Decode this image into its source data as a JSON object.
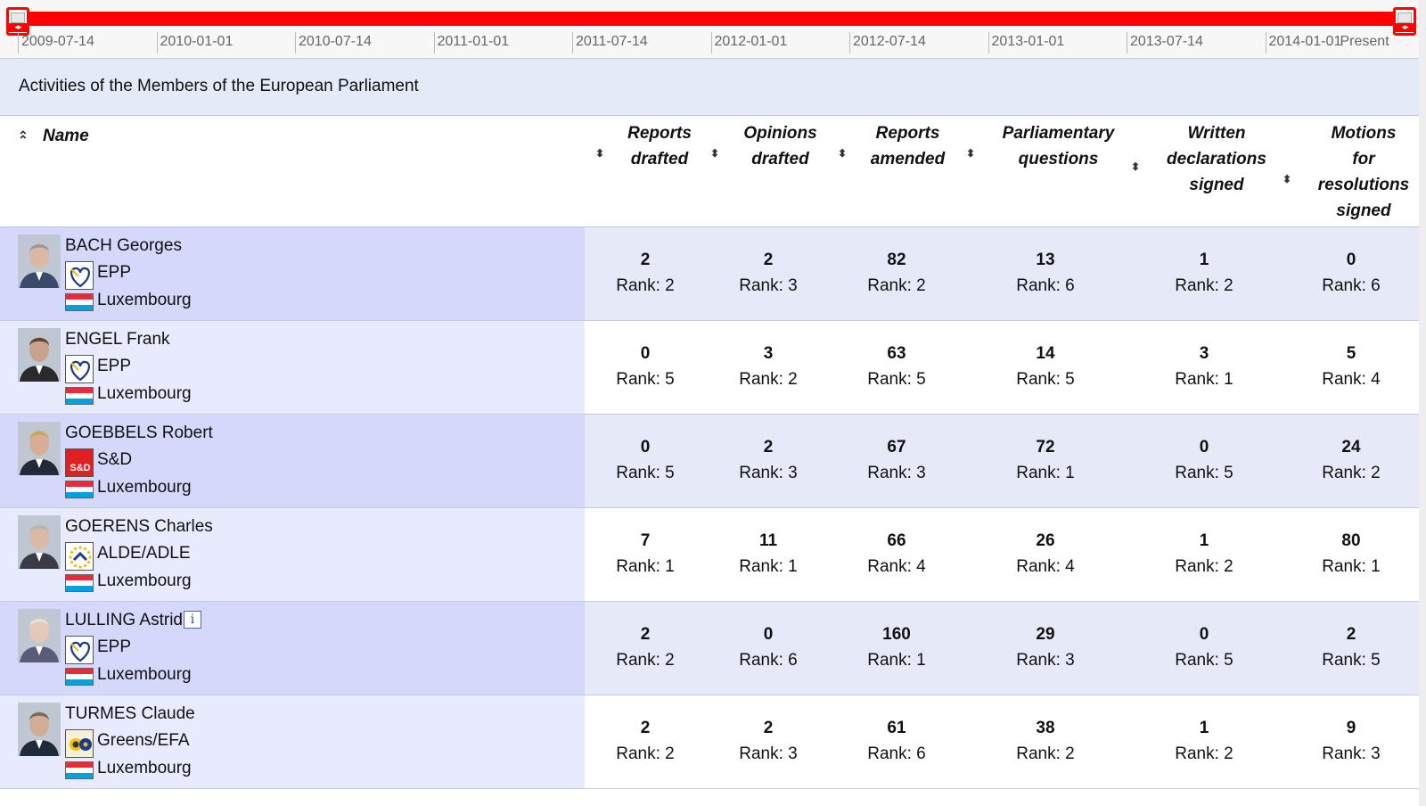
{
  "timeline": {
    "ticks": [
      "2009-07-14",
      "2010-01-01",
      "2010-07-14",
      "2011-01-01",
      "2011-07-14",
      "2012-01-01",
      "2012-07-14",
      "2013-01-01",
      "2013-07-14",
      "2014-01-01"
    ],
    "end_label": "Present",
    "track_color": "#ff0000"
  },
  "page_title": "Activities of the Members of the European Parliament",
  "columns": {
    "name": "Name",
    "reports_drafted": [
      "Reports",
      "drafted"
    ],
    "opinions_drafted": [
      "Opinions",
      "drafted"
    ],
    "reports_amended": [
      "Reports",
      "amended"
    ],
    "parliamentary_questions": [
      "Parliamentary",
      "questions"
    ],
    "written_declarations": [
      "Written",
      "declarations",
      "signed"
    ],
    "motions": [
      "Motions",
      "for",
      "resolutions",
      "signed"
    ]
  },
  "icons": {
    "sort_asc": "double-chevron-up-icon",
    "sort_both": "up-down-icon",
    "info": "info-icon"
  },
  "members": [
    {
      "name": "BACH Georges",
      "has_info": false,
      "party": "EPP",
      "party_logo": "epp-heart-icon",
      "country": "Luxembourg",
      "stats": [
        {
          "value": "2",
          "rank": "Rank: 2"
        },
        {
          "value": "2",
          "rank": "Rank: 3"
        },
        {
          "value": "82",
          "rank": "Rank: 2"
        },
        {
          "value": "13",
          "rank": "Rank: 6"
        },
        {
          "value": "1",
          "rank": "Rank: 2"
        },
        {
          "value": "0",
          "rank": "Rank: 6"
        }
      ]
    },
    {
      "name": "ENGEL Frank",
      "has_info": false,
      "party": "EPP",
      "party_logo": "epp-heart-icon",
      "country": "Luxembourg",
      "stats": [
        {
          "value": "0",
          "rank": "Rank: 5"
        },
        {
          "value": "3",
          "rank": "Rank: 2"
        },
        {
          "value": "63",
          "rank": "Rank: 5"
        },
        {
          "value": "14",
          "rank": "Rank: 5"
        },
        {
          "value": "3",
          "rank": "Rank: 1"
        },
        {
          "value": "5",
          "rank": "Rank: 4"
        }
      ]
    },
    {
      "name": "GOEBBELS Robert",
      "has_info": false,
      "party": "S&D",
      "party_logo": "sd-logo-icon",
      "party_logo_text": "S&D",
      "country": "Luxembourg",
      "stats": [
        {
          "value": "0",
          "rank": "Rank: 5"
        },
        {
          "value": "2",
          "rank": "Rank: 3"
        },
        {
          "value": "67",
          "rank": "Rank: 3"
        },
        {
          "value": "72",
          "rank": "Rank: 1"
        },
        {
          "value": "0",
          "rank": "Rank: 5"
        },
        {
          "value": "24",
          "rank": "Rank: 2"
        }
      ]
    },
    {
      "name": "GOERENS Charles",
      "has_info": false,
      "party": "ALDE/ADLE",
      "party_logo": "alde-stars-icon",
      "country": "Luxembourg",
      "stats": [
        {
          "value": "7",
          "rank": "Rank: 1"
        },
        {
          "value": "11",
          "rank": "Rank: 1"
        },
        {
          "value": "66",
          "rank": "Rank: 4"
        },
        {
          "value": "26",
          "rank": "Rank: 4"
        },
        {
          "value": "1",
          "rank": "Rank: 2"
        },
        {
          "value": "80",
          "rank": "Rank: 1"
        }
      ]
    },
    {
      "name": "LULLING Astrid",
      "has_info": true,
      "party": "EPP",
      "party_logo": "epp-heart-icon",
      "country": "Luxembourg",
      "stats": [
        {
          "value": "2",
          "rank": "Rank: 2"
        },
        {
          "value": "0",
          "rank": "Rank: 6"
        },
        {
          "value": "160",
          "rank": "Rank: 1"
        },
        {
          "value": "29",
          "rank": "Rank: 3"
        },
        {
          "value": "0",
          "rank": "Rank: 5"
        },
        {
          "value": "2",
          "rank": "Rank: 5"
        }
      ]
    },
    {
      "name": "TURMES Claude",
      "has_info": false,
      "party": "Greens/EFA",
      "party_logo": "greens-sunflower-icon",
      "country": "Luxembourg",
      "stats": [
        {
          "value": "2",
          "rank": "Rank: 2"
        },
        {
          "value": "2",
          "rank": "Rank: 3"
        },
        {
          "value": "61",
          "rank": "Rank: 6"
        },
        {
          "value": "38",
          "rank": "Rank: 2"
        },
        {
          "value": "1",
          "rank": "Rank: 2"
        },
        {
          "value": "9",
          "rank": "Rank: 3"
        }
      ]
    }
  ],
  "colors": {
    "header_bg": "#e4ebf8",
    "name_cell_dark": "#d4d8fb",
    "name_cell_light": "#e8eafd",
    "flag_lu": [
      "#ed2939",
      "#ffffff",
      "#00a1de"
    ]
  },
  "info_glyph": "i"
}
